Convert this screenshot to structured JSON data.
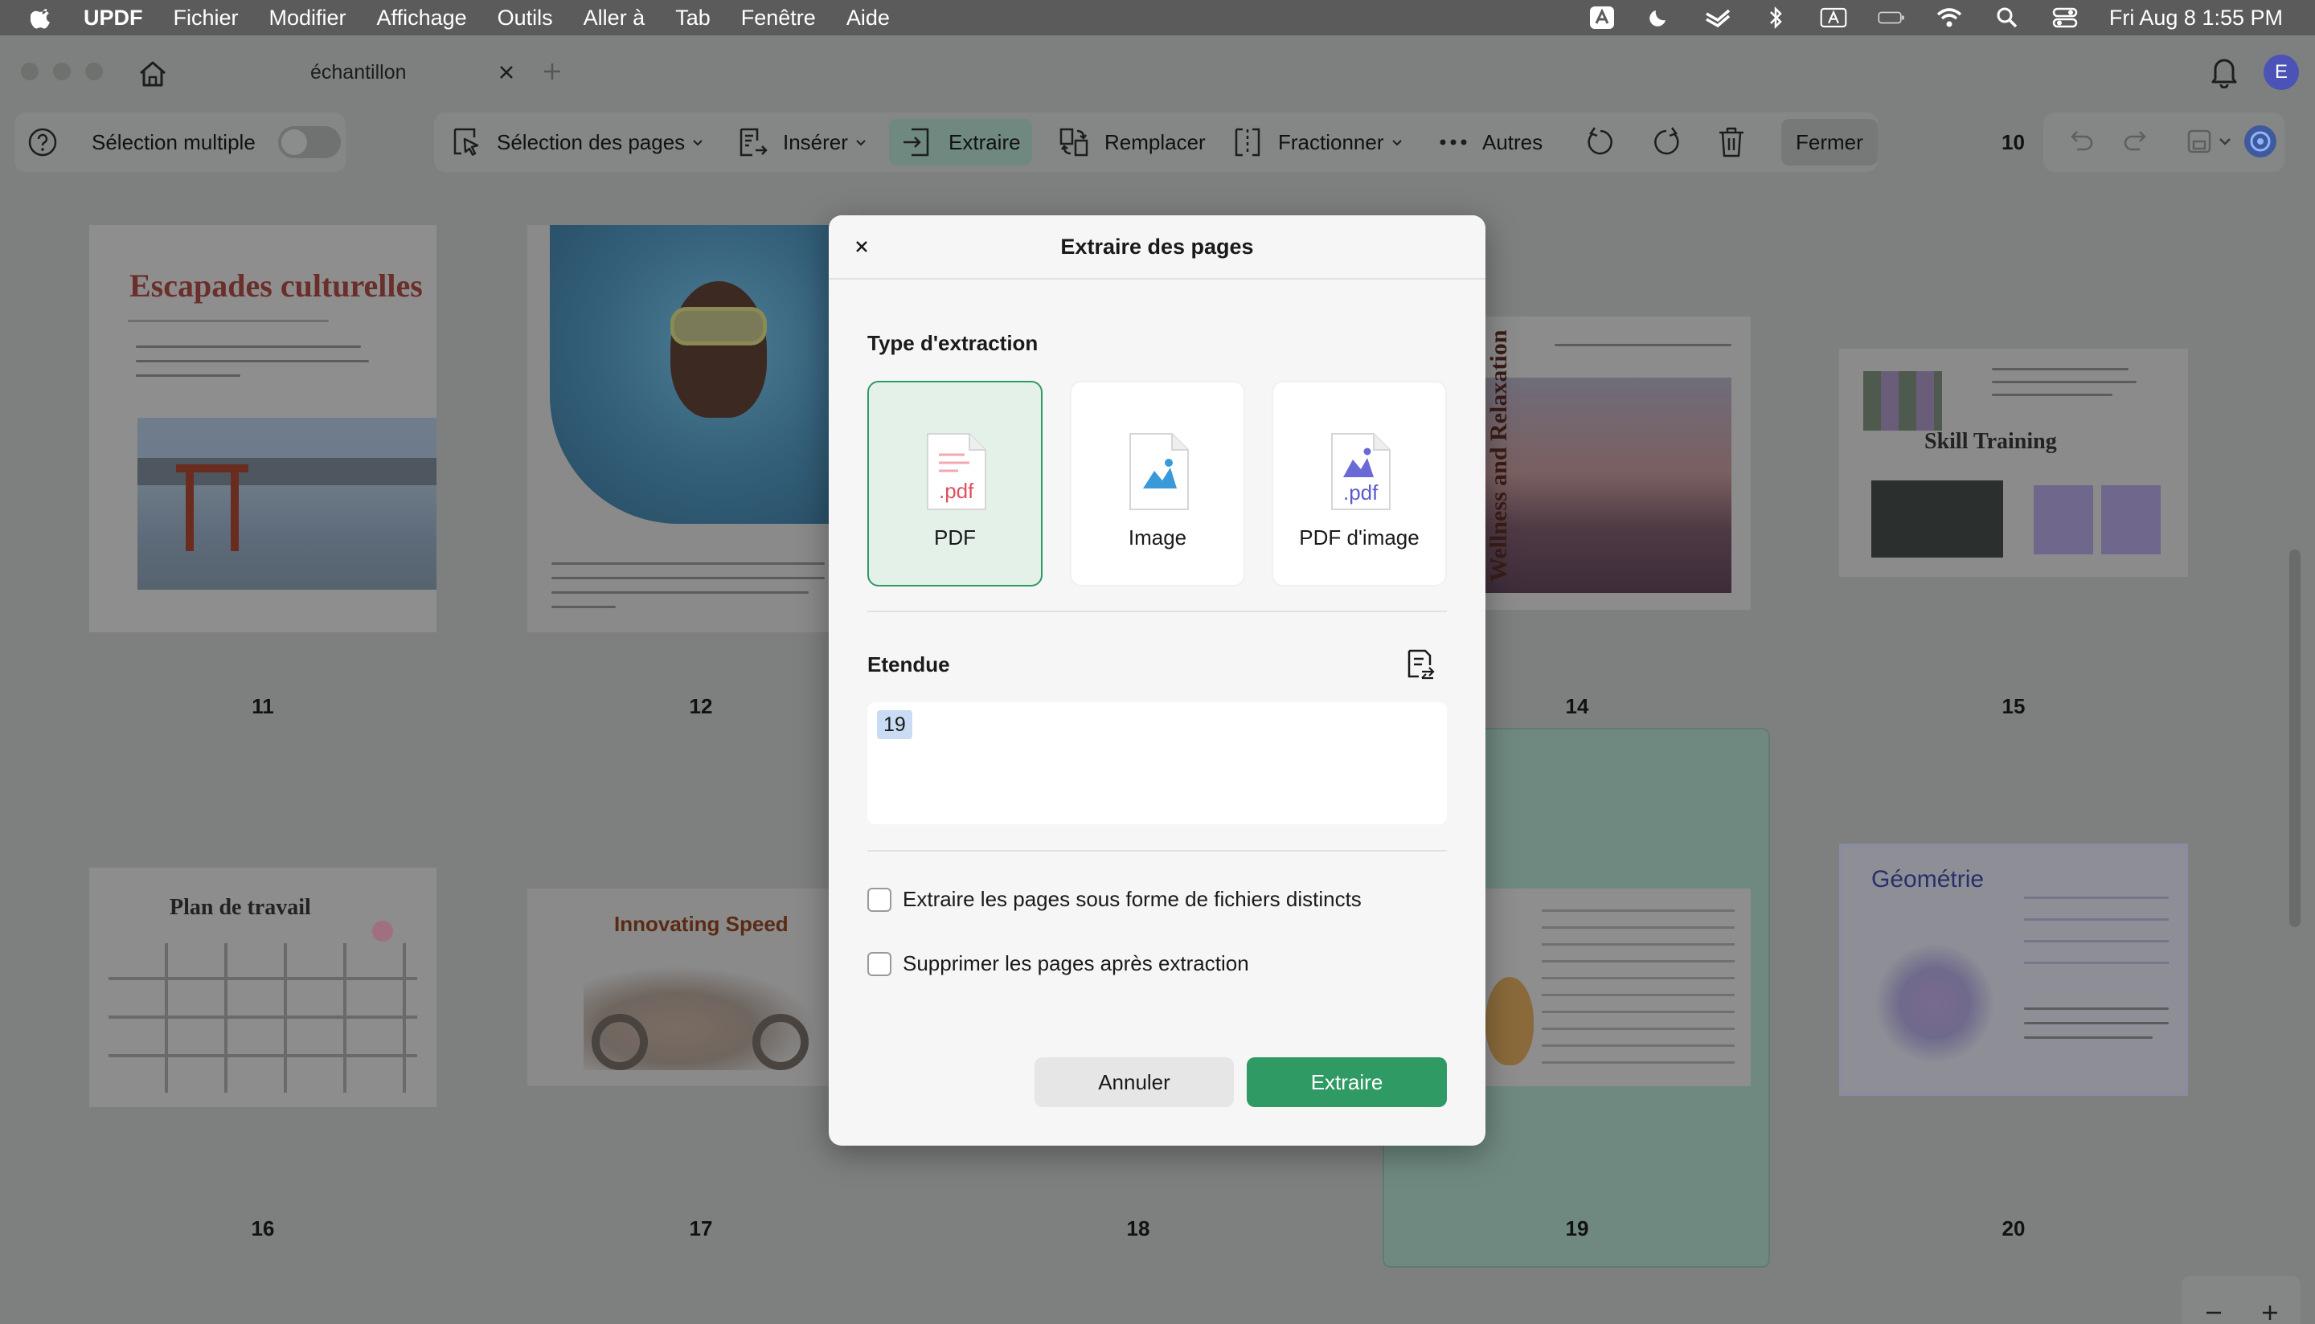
{
  "menubar": {
    "app_name": "UPDF",
    "items": [
      "Fichier",
      "Modifier",
      "Affichage",
      "Outils",
      "Aller à",
      "Tab",
      "Fenêtre",
      "Aide"
    ],
    "clock": "Fri Aug 8  1:55 PM"
  },
  "window": {
    "tab_title": "échantillon",
    "avatar_letter": "E"
  },
  "toolbar": {
    "multi_select_label": "Sélection multiple",
    "page_select_label": "Sélection des pages",
    "insert_label": "Insérer",
    "extract_label": "Extraire",
    "replace_label": "Remplacer",
    "split_label": "Fractionner",
    "more_label": "Autres",
    "close_label": "Fermer",
    "current_page": "10"
  },
  "pages": {
    "p11": {
      "number": "11",
      "title": "Escapades culturelles"
    },
    "p12": {
      "number": "12"
    },
    "p14": {
      "number": "14",
      "title": "Wellness and Relaxation"
    },
    "p15": {
      "number": "15",
      "title": "Skill Training"
    },
    "p16": {
      "number": "16",
      "title": "Plan de travail"
    },
    "p17": {
      "number": "17",
      "title": "Innovating Speed"
    },
    "p18": {
      "number": "18"
    },
    "p19": {
      "number": "19"
    },
    "p20": {
      "number": "20",
      "title": "Géométrie"
    }
  },
  "dialog": {
    "title": "Extraire des pages",
    "type_label": "Type d'extraction",
    "options": [
      {
        "label": "PDF",
        "selected": true,
        "badge": ".pdf"
      },
      {
        "label": "Image",
        "selected": false
      },
      {
        "label": "PDF d'image",
        "selected": false,
        "badge": ".pdf"
      }
    ],
    "range_label": "Etendue",
    "range_value": "19",
    "checkbox_separate": "Extraire les pages sous forme de fichiers distincts",
    "checkbox_delete": "Supprimer les pages après extraction",
    "cancel_label": "Annuler",
    "confirm_label": "Extraire"
  },
  "colors": {
    "accent": "#2f9a63",
    "selection": "#6f8981"
  }
}
